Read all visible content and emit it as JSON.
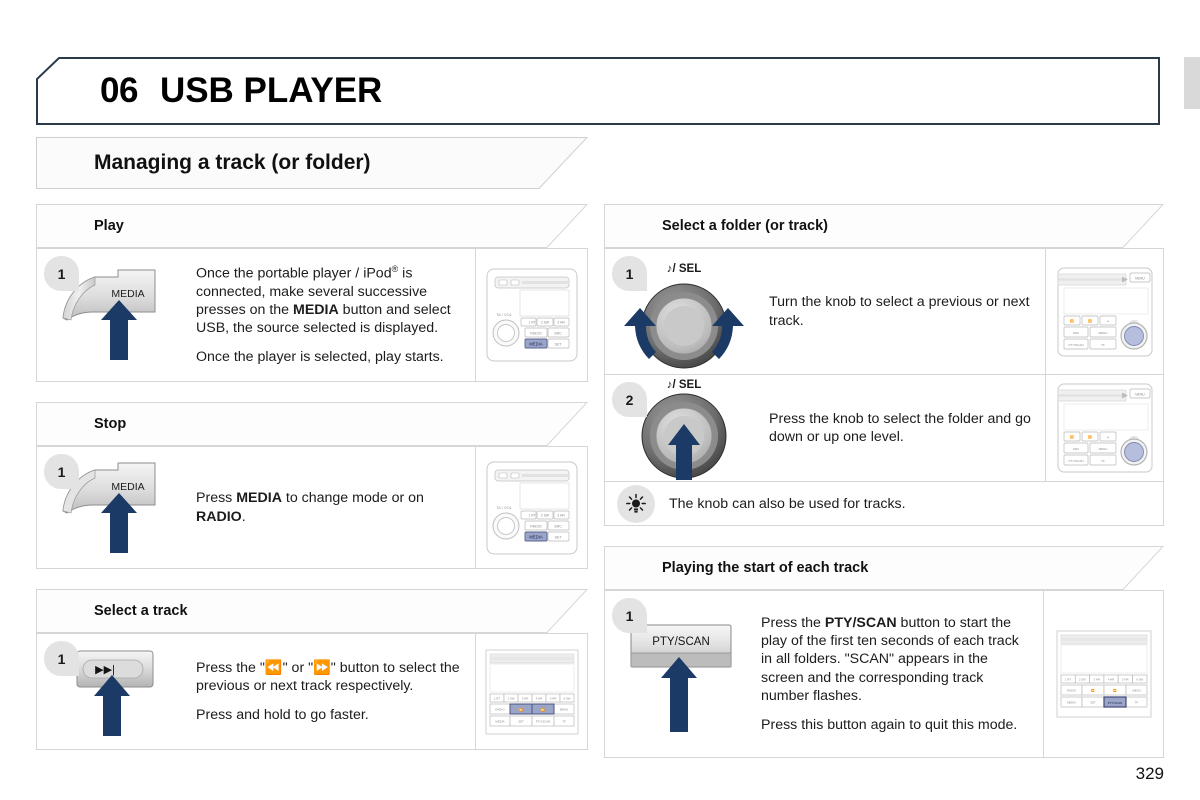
{
  "page": {
    "number": "329",
    "chapter_number": "06",
    "chapter_title": "USB PLAYER",
    "section_title": "Managing a track (or folder)",
    "accent_border": "#2b3a4a",
    "arrow_color": "#1b3a66",
    "highlight_color": "#9aa5c8"
  },
  "left_column": {
    "sections": [
      {
        "heading": "Play",
        "steps": [
          {
            "number": "1",
            "figure": "media-button-panel",
            "figure_label": "MEDIA",
            "paragraphs": [
              {
                "runs": [
                  {
                    "text": "Once the portable player / iPod",
                    "bold": false
                  },
                  {
                    "text": "®",
                    "bold": false,
                    "sup": true
                  },
                  {
                    "text": " is connected, make several successive presses on the ",
                    "bold": false
                  },
                  {
                    "text": "MEDIA",
                    "bold": true
                  },
                  {
                    "text": " button and select USB, the source selected is displayed.",
                    "bold": false
                  }
                ]
              },
              {
                "runs": [
                  {
                    "text": "Once the player is selected, play starts.",
                    "bold": false
                  }
                ]
              }
            ],
            "panel": "radio-face-media-highlight"
          }
        ]
      },
      {
        "heading": "Stop",
        "steps": [
          {
            "number": "1",
            "figure": "media-button-panel",
            "figure_label": "MEDIA",
            "paragraphs": [
              {
                "runs": [
                  {
                    "text": "Press ",
                    "bold": false
                  },
                  {
                    "text": "MEDIA",
                    "bold": true
                  },
                  {
                    "text": " to change mode or on ",
                    "bold": false
                  },
                  {
                    "text": "RADIO",
                    "bold": true
                  },
                  {
                    "text": ".",
                    "bold": false
                  }
                ]
              }
            ],
            "panel": "radio-face-media-highlight"
          }
        ]
      },
      {
        "heading": "Select a track",
        "steps": [
          {
            "number": "1",
            "figure": "track-skip-button",
            "figure_label": "▶▶|",
            "paragraphs": [
              {
                "runs": [
                  {
                    "text": "Press the \"◀◀\" or \"▶▶\" button to select the previous or next track respectively.",
                    "bold": false
                  }
                ]
              },
              {
                "runs": [
                  {
                    "text": "Press and hold to go faster.",
                    "bold": false
                  }
                ]
              }
            ],
            "panel": "radio-face-skip-highlight"
          }
        ]
      }
    ]
  },
  "right_column": {
    "sections": [
      {
        "heading": "Select a folder (or track)",
        "steps": [
          {
            "number": "1",
            "figure": "rotary-knob-turn",
            "figure_label": "♪/ SEL",
            "paragraphs": [
              {
                "runs": [
                  {
                    "text": "Turn the knob to select a previous or next track.",
                    "bold": false
                  }
                ]
              }
            ],
            "panel": "radio-face-knob-highlight"
          },
          {
            "number": "2",
            "figure": "rotary-knob-press",
            "figure_label": "♪/ SEL",
            "paragraphs": [
              {
                "runs": [
                  {
                    "text": "Press the knob to select the folder and go down or up one level.",
                    "bold": false
                  }
                ]
              }
            ],
            "panel": "radio-face-knob-highlight"
          }
        ],
        "tip": {
          "icon": "tip-bulb-icon",
          "text": "The knob can also be used for tracks."
        }
      },
      {
        "heading": "Playing the start of each track",
        "steps": [
          {
            "number": "1",
            "figure": "pty-scan-button",
            "figure_label": "PTY/SCAN",
            "paragraphs": [
              {
                "runs": [
                  {
                    "text": "Press the ",
                    "bold": false
                  },
                  {
                    "text": "PTY/SCAN",
                    "bold": true
                  },
                  {
                    "text": " button to start the play of the first ten seconds of each track in all folders. \"SCAN\" appears in the screen and the corresponding track number flashes.",
                    "bold": false
                  }
                ]
              },
              {
                "runs": [
                  {
                    "text": "Press this button again to quit this mode.",
                    "bold": false
                  }
                ]
              }
            ],
            "panel": "radio-face-ptyscan-highlight"
          }
        ]
      }
    ]
  },
  "radio_faces": {
    "media_highlight": {
      "buttons": [
        "1 RT",
        "2 SW",
        "3 HR",
        "RADIO",
        "SRC",
        "MEDIA",
        "SET"
      ],
      "highlighted": "MEDIA",
      "knob_label": "TA / VOL"
    },
    "skip_highlight": {
      "buttons": [
        "1 RT",
        "2 SW",
        "3 HR",
        "4 HR",
        "5 HR",
        "6 SW",
        "RADIO",
        "◀◀",
        "▶▶",
        "MENU",
        "MEDIA",
        "SET",
        "PTY/SCAN",
        "TF"
      ],
      "highlighted": "◀◀ ▶▶"
    },
    "knob_highlight": {
      "buttons": [
        "◀◀",
        "▶▶",
        "▶▶|",
        "SRC",
        "MENU",
        "PTY/SCAN",
        "TF",
        "RADIO"
      ],
      "highlighted": "knob",
      "knob_label": "♪/SEL"
    },
    "ptyscan_highlight": {
      "buttons": [
        "1 RT",
        "2 SW",
        "3 HR",
        "4 HR",
        "5 HR",
        "6 SW",
        "RADIO",
        "◀◀",
        "▶▶",
        "MENU",
        "MEDIA",
        "SET",
        "PTY/SCAN",
        "TF"
      ],
      "highlighted": "PTY/SCAN"
    }
  }
}
